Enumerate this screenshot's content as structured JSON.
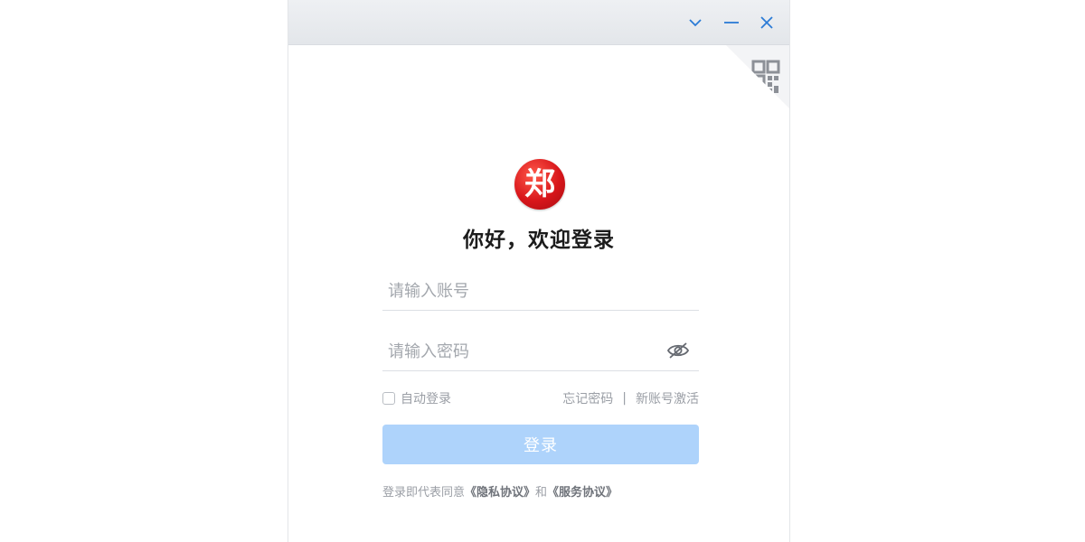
{
  "titlebar": {
    "buttons": {
      "dropdown": "chevron-down-icon",
      "minimize": "minimize-icon",
      "close": "close-icon"
    }
  },
  "qr_login": {
    "icon": "qr-code-icon"
  },
  "logo": {
    "glyph": "郑"
  },
  "welcome": {
    "title": "你好，欢迎登录"
  },
  "form": {
    "account_placeholder": "请输入账号",
    "password_placeholder": "请输入密码",
    "password_toggle_icon": "eye-off-icon",
    "auto_login_label": "自动登录",
    "forgot_password": "忘记密码",
    "separator": "|",
    "activate_account": "新账号激活",
    "login_button": "登录"
  },
  "agreement": {
    "prefix": "登录即代表同意",
    "privacy": "《隐私协议》",
    "conjunction": "和",
    "service": "《服务协议》"
  },
  "colors": {
    "login_button_bg": "#aed3fb",
    "logo_red": "#d8161b",
    "titlebar_icon": "#2b7bd6"
  }
}
